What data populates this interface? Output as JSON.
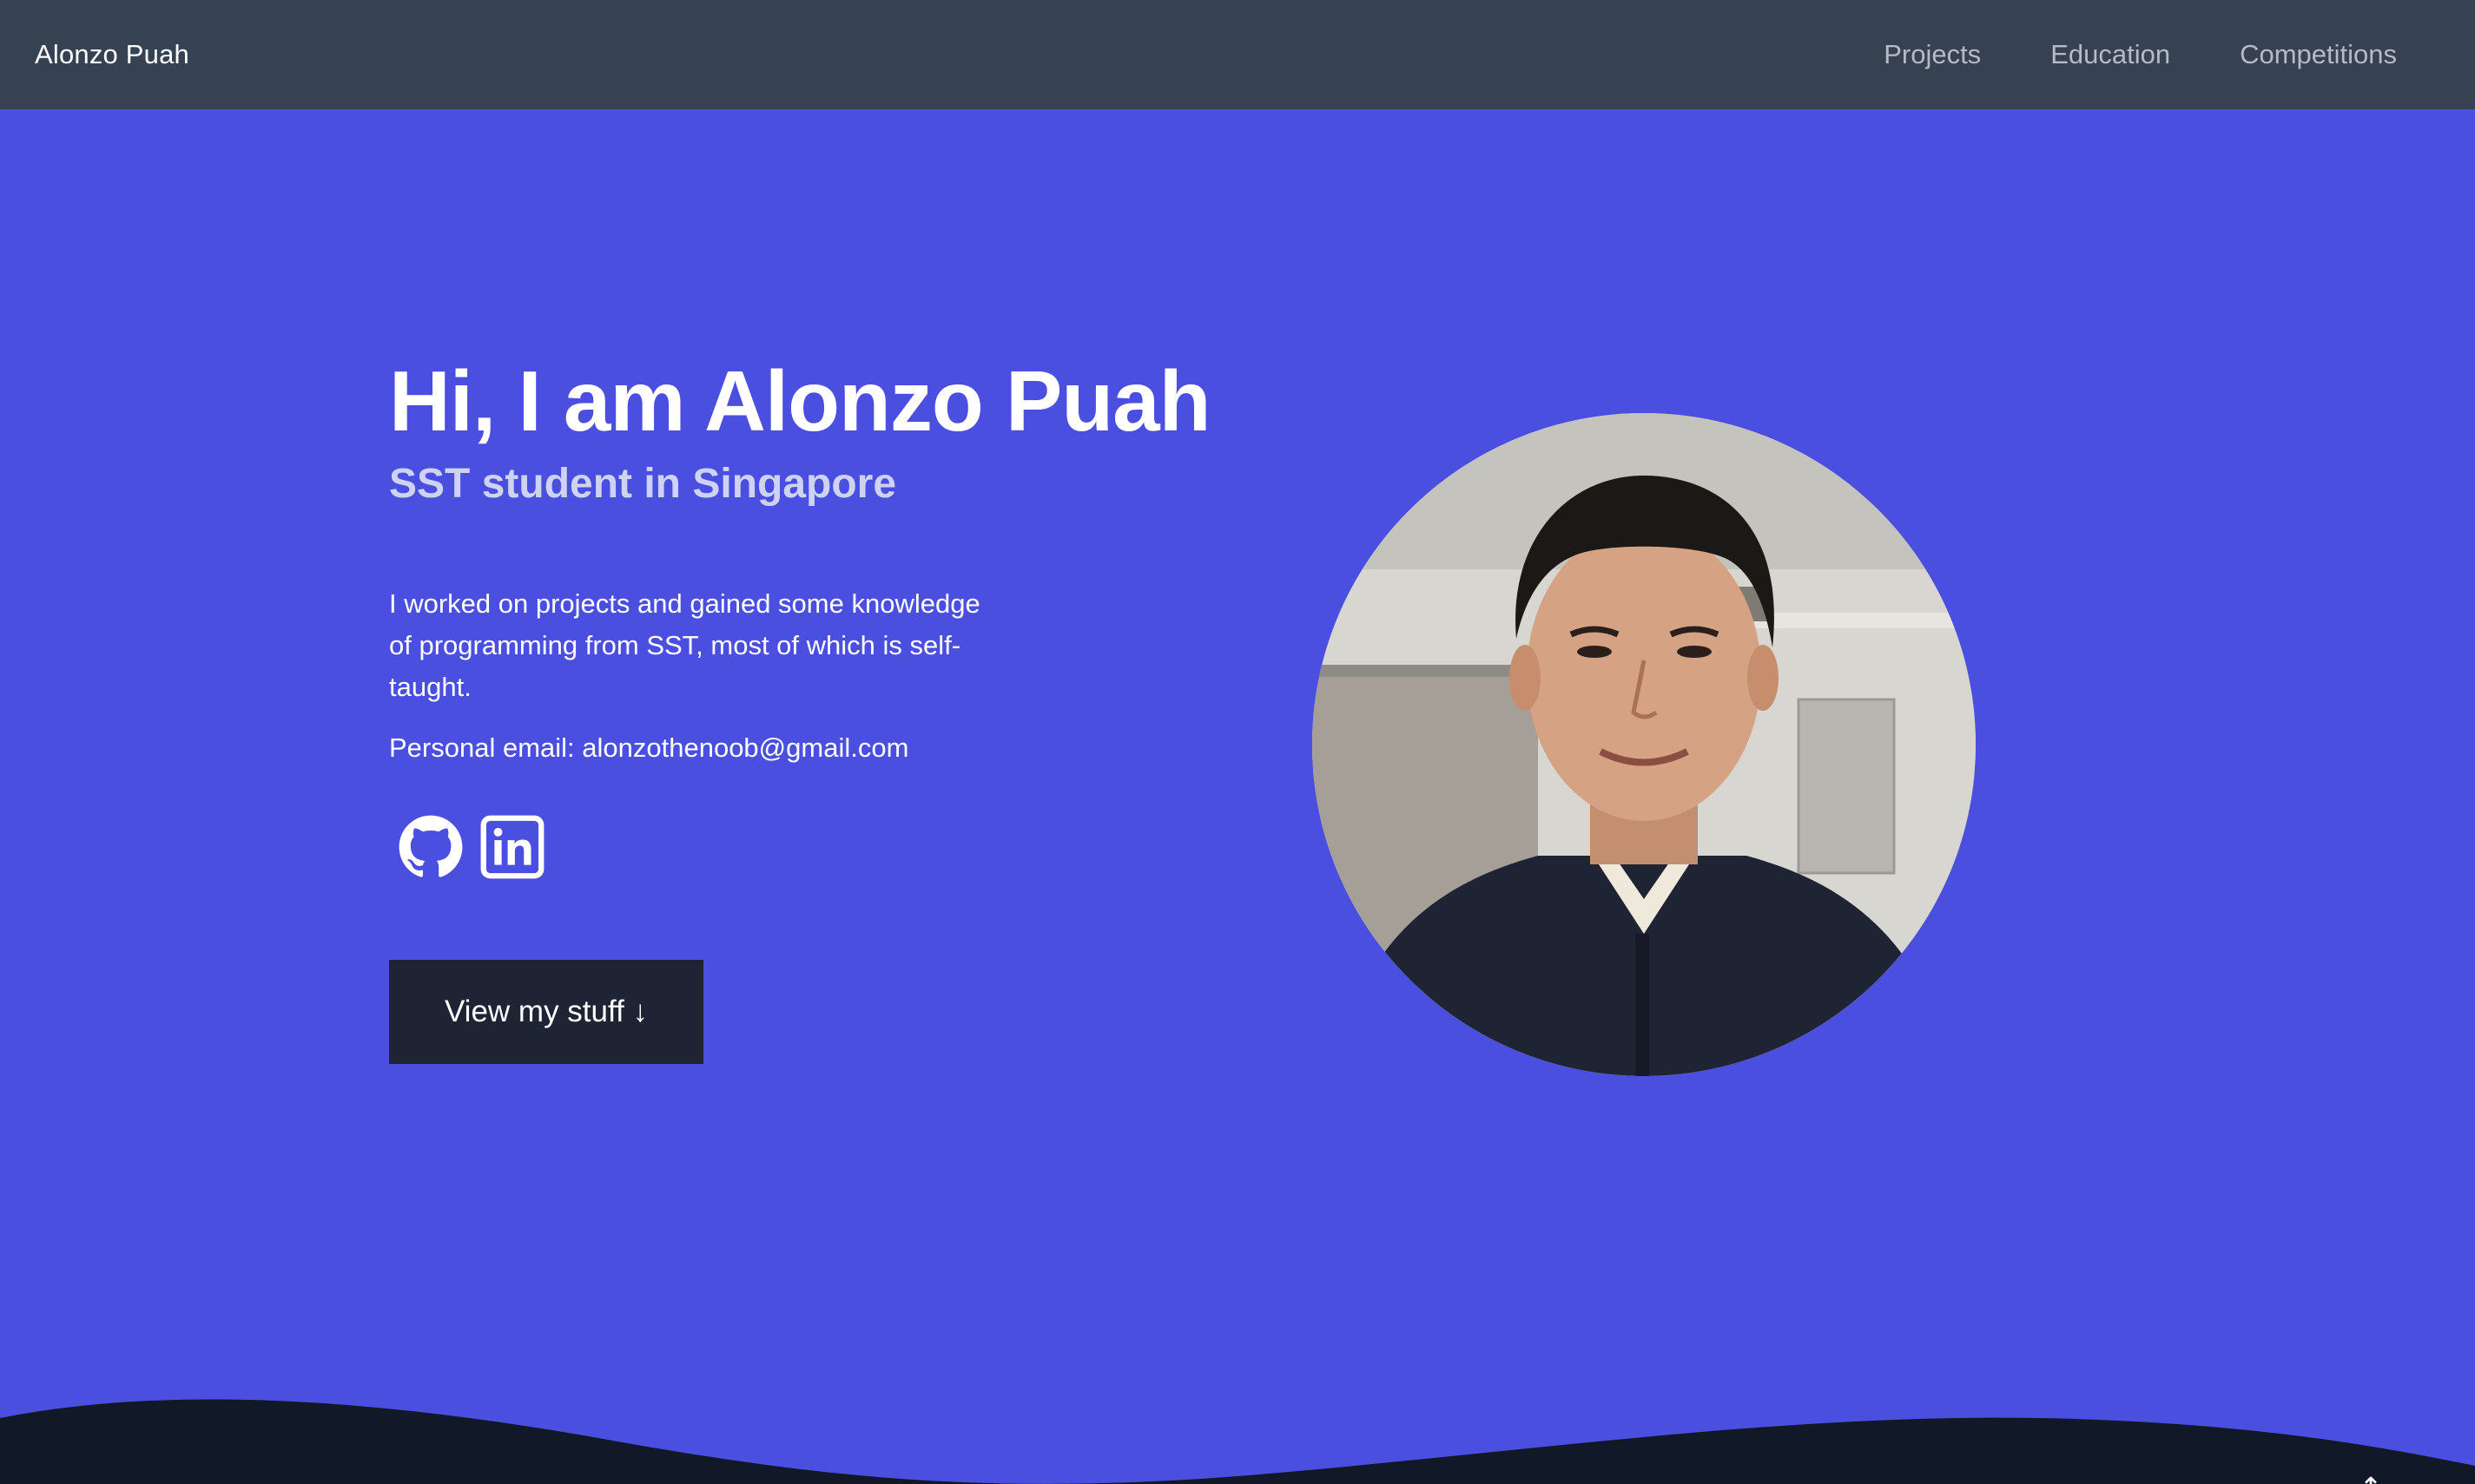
{
  "navbar": {
    "brand": "Alonzo Puah",
    "links": [
      {
        "label": "Projects"
      },
      {
        "label": "Education"
      },
      {
        "label": "Competitions"
      }
    ]
  },
  "hero": {
    "title": "Hi, I am Alonzo Puah",
    "subtitle": "SST student in Singapore",
    "bio": "I worked on projects and gained some knowledge of programming from SST, most of which is self-taught.",
    "email_line": "Personal email: alonzothenoob@gmail.com",
    "socials": [
      {
        "icon": "github-icon"
      },
      {
        "icon": "linkedin-icon"
      }
    ],
    "cta_label": "View my stuff ↓",
    "avatar_icon": "profile-photo"
  },
  "scroll_top": {
    "label": "↑"
  },
  "colors": {
    "navbar_bg": "#364152",
    "hero_bg": "#4b4fdf",
    "button_bg": "#1e2433",
    "wave": "#111827"
  }
}
